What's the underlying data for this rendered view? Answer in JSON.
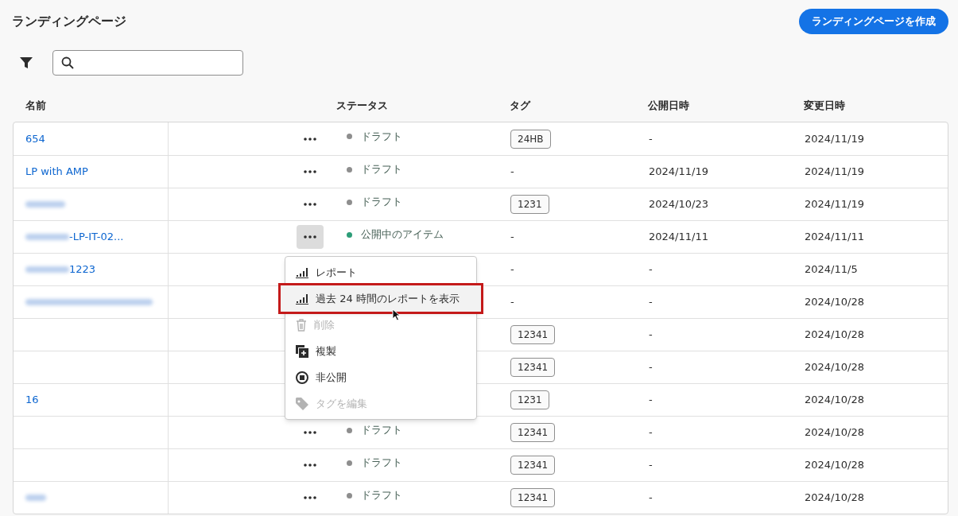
{
  "page": {
    "title": "ランディングページ",
    "create_button": "ランディングページを作成"
  },
  "table": {
    "columns": [
      "名前",
      "ステータス",
      "タグ",
      "公開日時",
      "変更日時"
    ],
    "rows": [
      {
        "name": "654",
        "blurred": false,
        "actions_selected": false,
        "status": {
          "label": "ドラフト",
          "color": "#8e8e8e"
        },
        "tag": {
          "kind": "chip",
          "text": "24HB"
        },
        "published": "-",
        "modified": "2024/11/19"
      },
      {
        "name": "LP with AMP",
        "blurred": false,
        "actions_selected": false,
        "status": {
          "label": "ドラフト",
          "color": "#8e8e8e"
        },
        "tag": {
          "kind": "text",
          "text": "-"
        },
        "published": "2024/11/19",
        "modified": "2024/11/19"
      },
      {
        "blurred": true,
        "actions_selected": false,
        "status": {
          "label": "ドラフト",
          "color": "#8e8e8e"
        },
        "tag": {
          "kind": "chip",
          "text": "1231"
        },
        "published": "2024/10/23",
        "modified": "2024/11/19"
      },
      {
        "name": "-LP-IT-02...",
        "blurred": true,
        "actions_selected": true,
        "status": {
          "label": "公開中のアイテム",
          "color": "#2d9d78"
        },
        "tag": {
          "kind": "text",
          "text": "-"
        },
        "published": "2024/11/11",
        "modified": "2024/11/11"
      },
      {
        "name": "1223",
        "blurred": true,
        "tag": {
          "kind": "text",
          "text": "-"
        },
        "published": "-",
        "modified": "2024/11/5"
      },
      {
        "blurred": true,
        "tag": {
          "kind": "text",
          "text": "-"
        },
        "published": "-",
        "modified": "2024/10/28"
      },
      {
        "blurred": false,
        "tag": {
          "kind": "chip",
          "text": "12341"
        },
        "published": "-",
        "modified": "2024/10/28"
      },
      {
        "blurred": false,
        "tag": {
          "kind": "chip",
          "text": "12341"
        },
        "published": "-",
        "modified": "2024/10/28"
      },
      {
        "name": "16",
        "blurred": false,
        "tag": {
          "kind": "chip",
          "text": "1231"
        },
        "published": "-",
        "modified": "2024/10/28"
      },
      {
        "blurred": false,
        "actions_selected": false,
        "status": {
          "label": "ドラフト",
          "color": "#8e8e8e"
        },
        "tag": {
          "kind": "chip",
          "text": "12341"
        },
        "published": "-",
        "modified": "2024/10/28"
      },
      {
        "blurred": false,
        "actions_selected": false,
        "status": {
          "label": "ドラフト",
          "color": "#8e8e8e"
        },
        "tag": {
          "kind": "chip",
          "text": "12341"
        },
        "published": "-",
        "modified": "2024/10/28"
      },
      {
        "blurred": true,
        "actions_selected": false,
        "status": {
          "label": "ドラフト",
          "color": "#8e8e8e"
        },
        "tag": {
          "kind": "chip",
          "text": "12341"
        },
        "published": "-",
        "modified": "2024/10/28"
      }
    ]
  },
  "menu": {
    "items": [
      {
        "kind": "report",
        "label": "レポート",
        "disabled": false,
        "highlighted": false
      },
      {
        "kind": "report",
        "label": "過去 24 時間のレポートを表示",
        "disabled": false,
        "highlighted": true
      },
      {
        "kind": "delete",
        "label": "削除",
        "disabled": true,
        "highlighted": false
      },
      {
        "kind": "duplicate",
        "label": "複製",
        "disabled": false,
        "highlighted": false
      },
      {
        "kind": "unpublish",
        "label": "非公開",
        "disabled": false,
        "highlighted": false
      },
      {
        "kind": "tag",
        "label": "タグを編集",
        "disabled": true,
        "highlighted": false
      }
    ]
  }
}
